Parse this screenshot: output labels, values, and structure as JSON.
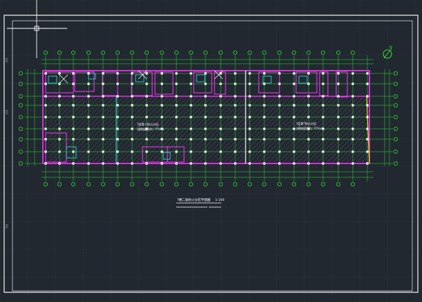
{
  "drawing": {
    "title": "?楼二层防火分区平面图",
    "scale_note": "1:100",
    "subtitle_rule": "",
    "zone_left_label": "?层第二防火分区",
    "zone_left_area": "(建筑面积约: ???m²)",
    "zone_right_label": "?层第?防火分区",
    "zone_right_area": "(建筑面积约: ???m²)",
    "edge_tags": [
      "???",
      "???",
      "???"
    ]
  },
  "colors": {
    "background": "#212830",
    "grid": "#2b333c",
    "frame": "#d9d9d9",
    "axis": "#33e033",
    "walls": "#ff33ff",
    "columns": "#ff2a2a",
    "annotation": "#ffffff",
    "accent_cyan": "#33e6e6",
    "accent_yellow": "#e6e600"
  },
  "cursor": {
    "name": "crosshair-cursor"
  }
}
